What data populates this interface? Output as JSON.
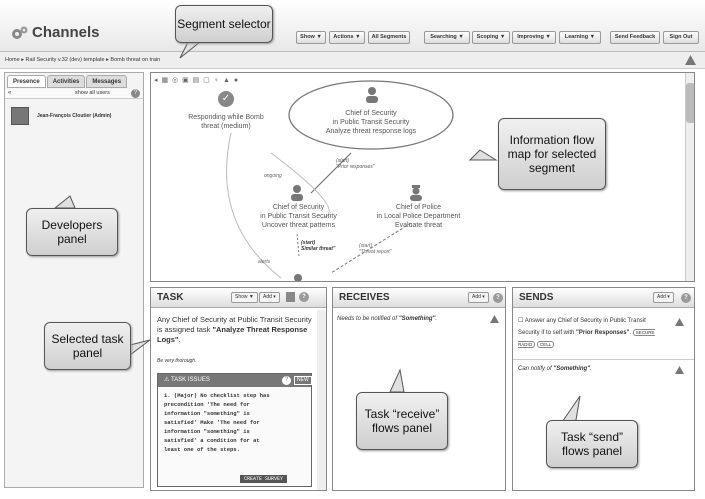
{
  "app": {
    "title": "Channels"
  },
  "toolbar": {
    "show": "Show ▼",
    "actions": "Actions ▼",
    "all_segments": "All Segments",
    "searching": "Searching ▼",
    "scoping": "Scoping ▼",
    "improving": "Improving ▼",
    "learning": "Learning ▼",
    "send_feedback": "Send Feedback",
    "sign_out": "Sign Out"
  },
  "breadcrumb": {
    "home": "Home",
    "plan": "Rail Security v.32 (dev) template",
    "segment": "Bomb threat on train"
  },
  "left": {
    "tabs": [
      "Presence",
      "Activities",
      "Messages"
    ],
    "show_all": "show all users",
    "user": "Jean-François Cloutier (Admin)"
  },
  "map": {
    "n1_l1": "Responding while Bomb",
    "n1_l2": "threat (medium)",
    "n2_l1": "Chief of Security",
    "n2_l2": "in Public Transit Security",
    "n2_l3": "Analyze threat response logs",
    "n3_l1": "Chief of Security",
    "n3_l2": "in Public Transit Security",
    "n3_l3": "Uncover threat patterns",
    "n4_l1": "Chief of Police",
    "n4_l2": "in Local Police Department",
    "n4_l3": "Evaluate threat",
    "e1_a": "(start)",
    "e1_b": "\"Prior responses\"",
    "e2": "ongoing",
    "e3_a": "(start)",
    "e3_b": "Similar threat\"",
    "e4_a": "(start)",
    "e4_b": "\"Threat report\"",
    "e5": "alerts"
  },
  "task": {
    "title": "TASK",
    "show": "Show ▼",
    "add": "Add ▾",
    "text1": "Any Chief of Security at Public Transit Security is assigned task ",
    "task_name": "\"Analyze Threat Response Logs\"",
    "text2": ".",
    "note": "Be very thorough.",
    "issues_title": "TASK ISSUES",
    "new": "NEW",
    "issue_lines": [
      "1. (Major) No checklist step has",
      "precondition 'The need for",
      "information \"something\" is",
      "satisfied' Make 'The need for",
      "information \"something\" is",
      "satisfied' a condition for at",
      "least one of the steps."
    ],
    "create": "CREATE SURVEY"
  },
  "receives": {
    "title": "RECEIVES",
    "add": "Add ▾",
    "text": "Needs to be notified of ",
    "item": "\"Something\"",
    "end": "."
  },
  "sends": {
    "title": "SENDS",
    "add": "Add ▾",
    "text1": "Answer any Chief of Security in Public Transit Security if to self with ",
    "item1": "\"Prior Responses\"",
    "end1": ".",
    "tag1": "SECURE RADIO",
    "tag2": "CELL",
    "text2": "Can notify of ",
    "item2": "\"Something\"",
    "end2": "."
  },
  "callouts": {
    "segment": "Segment selector",
    "dev": "Developers panel",
    "info": "Information flow map for selected segment",
    "task": "Selected task panel",
    "recv": "Task “receive” flows panel",
    "send": "Task “send” flows panel"
  }
}
